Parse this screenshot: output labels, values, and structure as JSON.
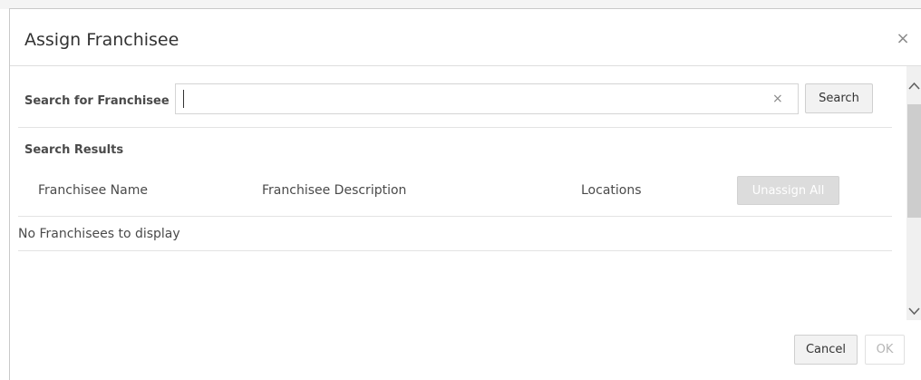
{
  "dialog": {
    "title": "Assign Franchisee",
    "close_glyph": "×"
  },
  "search": {
    "label": "Search for Franchisee",
    "value": "",
    "placeholder": "",
    "clear_glyph": "×",
    "button_label": "Search"
  },
  "results": {
    "section_label": "Search Results",
    "columns": [
      "Franchisee Name",
      "Franchisee Description",
      "Locations"
    ],
    "unassign_all_label": "Unassign All",
    "empty_message": "No Franchisees to display",
    "rows": []
  },
  "footer": {
    "cancel_label": "Cancel",
    "ok_label": "OK"
  },
  "icons": {
    "close": "close-icon",
    "clear": "clear-icon",
    "scroll_up": "chevron-up-icon",
    "scroll_down": "chevron-down-icon"
  },
  "colors": {
    "disabled_button_bg": "#dcdcdc",
    "button_bg": "#f2f2f2",
    "divider": "#e3e3e3",
    "text": "#4a4a4a"
  }
}
